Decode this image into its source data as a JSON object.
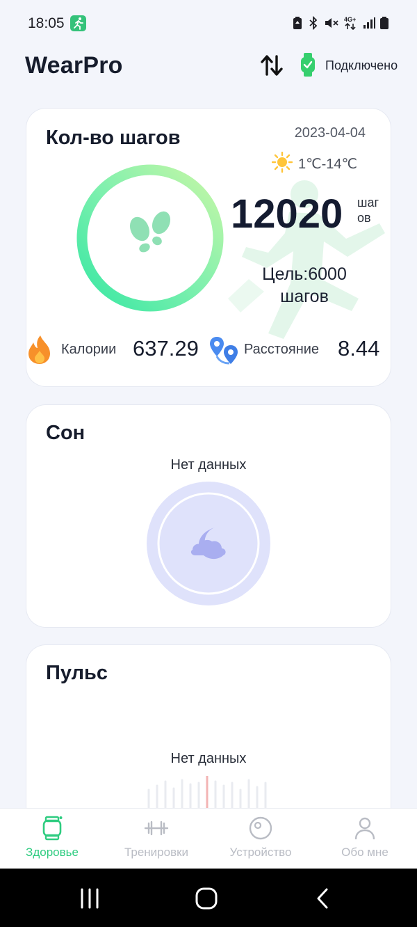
{
  "status_bar": {
    "time": "18:05",
    "icons": [
      "battery-saver-icon",
      "bluetooth-icon",
      "mute-icon",
      "4g-icon",
      "signal-icon",
      "battery-icon"
    ]
  },
  "header": {
    "title": "WearPro",
    "connection_status": "Подключено"
  },
  "steps_card": {
    "title": "Кол-во шагов",
    "date": "2023-04-04",
    "weather": "1℃-14℃",
    "steps": "12020",
    "steps_unit": "шагов",
    "goal": "Цель:6000 шагов",
    "goal_progress": 1.0,
    "calories_label": "Калории",
    "calories_value": "637.29",
    "distance_label": "Расстояние",
    "distance_value": "8.44"
  },
  "sleep_card": {
    "title": "Сон",
    "no_data": "Нет данных"
  },
  "pulse_card": {
    "title": "Пульс",
    "no_data": "Нет данных"
  },
  "bottom_nav": {
    "items": [
      {
        "label": "Здоровье",
        "icon": "watch-icon",
        "active": true
      },
      {
        "label": "Тренировки",
        "icon": "dumbbell-icon",
        "active": false
      },
      {
        "label": "Устройство",
        "icon": "device-icon",
        "active": false
      },
      {
        "label": "Обо мне",
        "icon": "person-icon",
        "active": false
      }
    ]
  },
  "colors": {
    "accent_green": "#2ecc80",
    "ring_start": "#3fe8a6",
    "ring_end": "#c6f7a8",
    "sleep_circle": "#dfe2fb",
    "calories_orange": "#f7902a",
    "distance_blue": "#4a8bf0"
  }
}
